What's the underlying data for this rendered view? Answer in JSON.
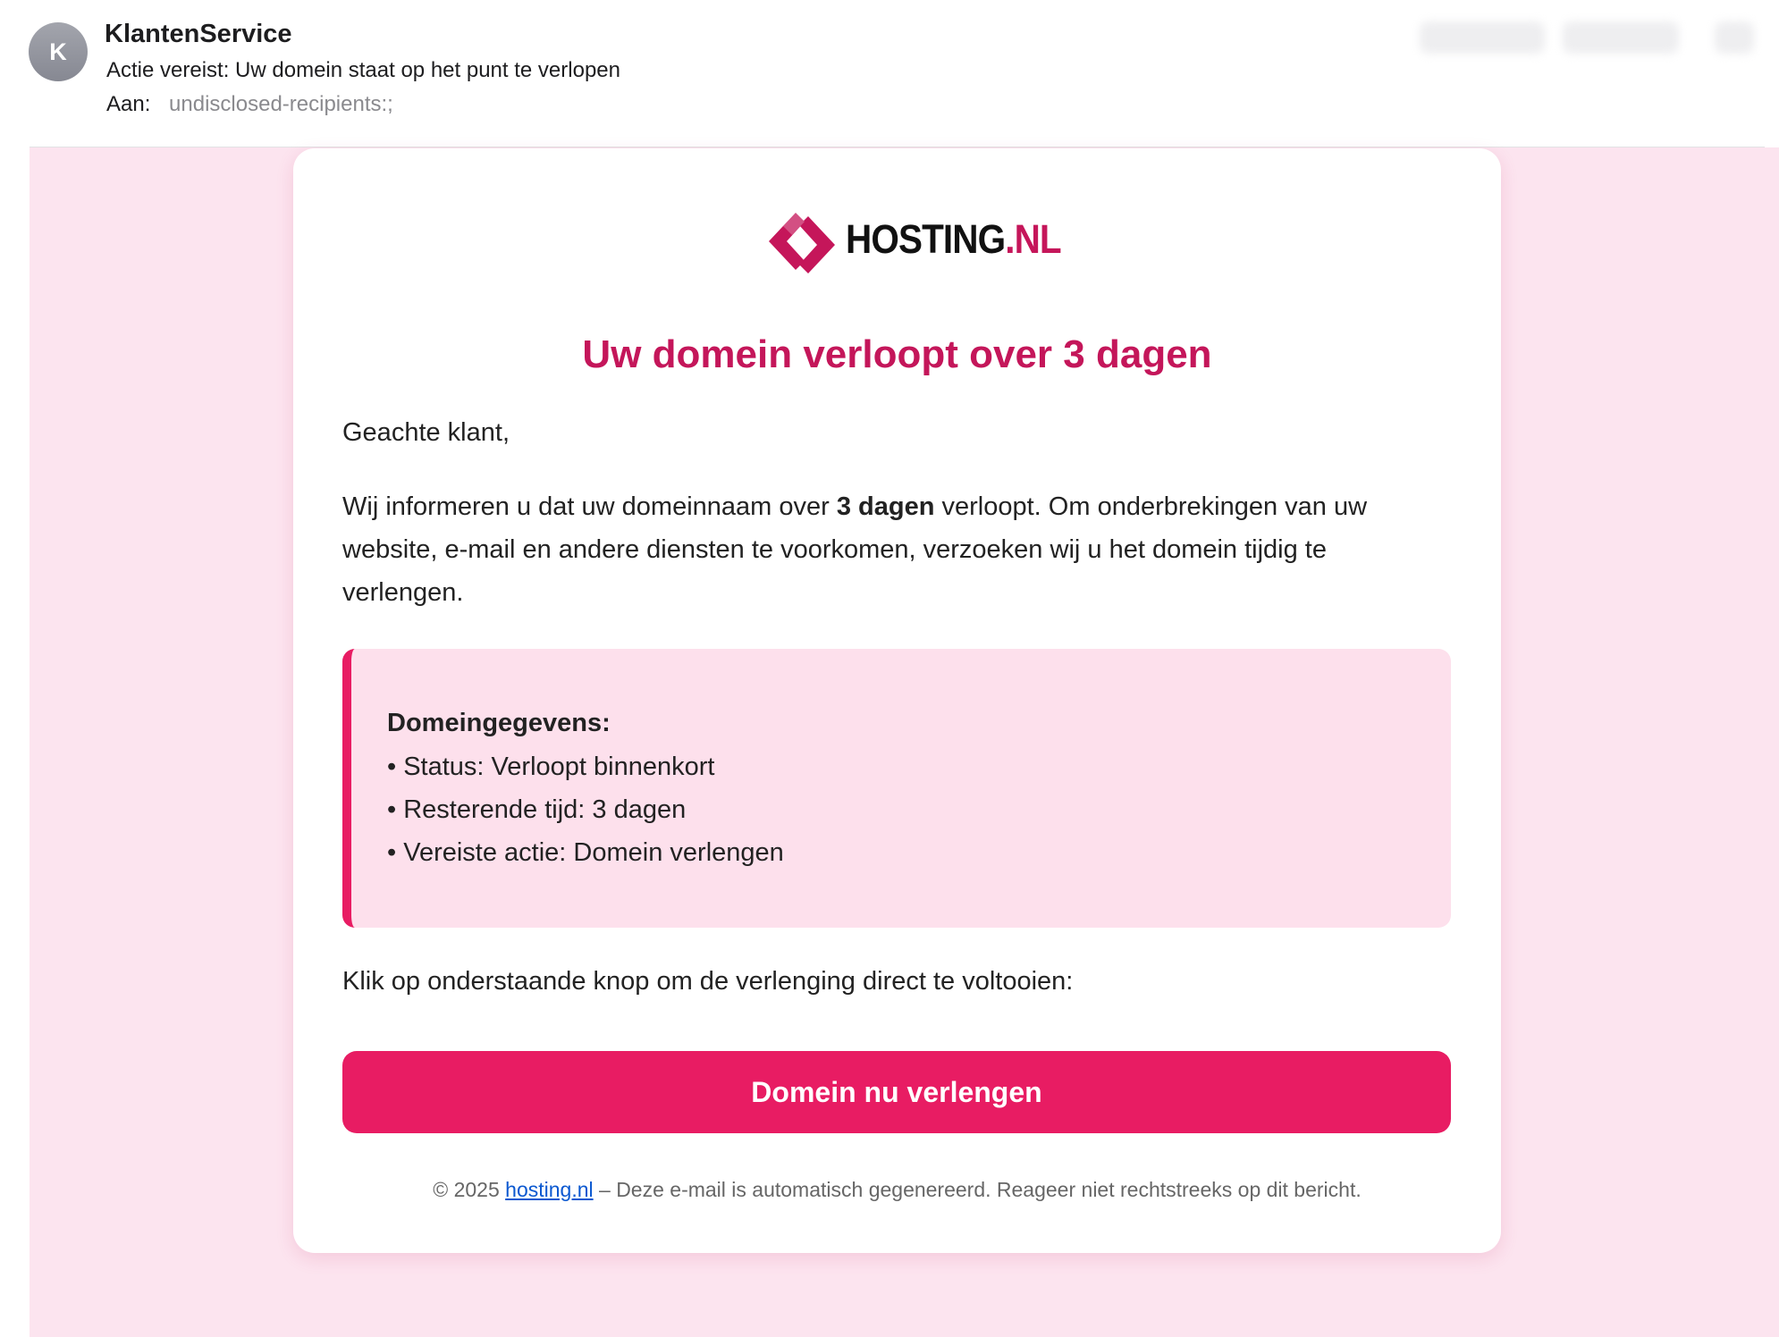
{
  "mail": {
    "avatar_initial": "K",
    "sender": "KlantenService",
    "subject": "Actie vereist: Uw domein staat op het punt te verlopen",
    "to_label": "Aan:",
    "to_value": "undisclosed-recipients:;"
  },
  "email": {
    "brand": {
      "name": "HOSTING",
      "tld": ".NL",
      "color": "#c5165a"
    },
    "headline": "Uw domein verloopt over 3 dagen",
    "greeting": "Geachte klant,",
    "intro": {
      "before": "Wij informeren u dat uw domeinnaam over ",
      "bold": "3 dagen",
      "after": " verloopt. Om onderbrekingen van uw website, e-mail en andere diensten te voorkomen, verzoeken wij u het domein tijdig te verlengen."
    },
    "details": {
      "title": "Domeingegevens:",
      "items": [
        "• Status: Verloopt binnenkort",
        "• Resterende tijd: 3 dagen",
        "• Vereiste actie: Domein verlengen"
      ]
    },
    "cta_text": "Klik op onderstaande knop om de verlenging direct te voltooien:",
    "cta_button": "Domein nu verlengen",
    "footer": {
      "prefix": "© 2025 ",
      "link": "hosting.nl",
      "suffix": " – Deze e-mail is automatisch gegenereerd. Reageer niet rechtstreeks op dit bericht."
    }
  },
  "colors": {
    "accent": "#e81c63",
    "headline": "#c4165a",
    "background": "#fce4ef",
    "info_box": "#fde0ec"
  }
}
